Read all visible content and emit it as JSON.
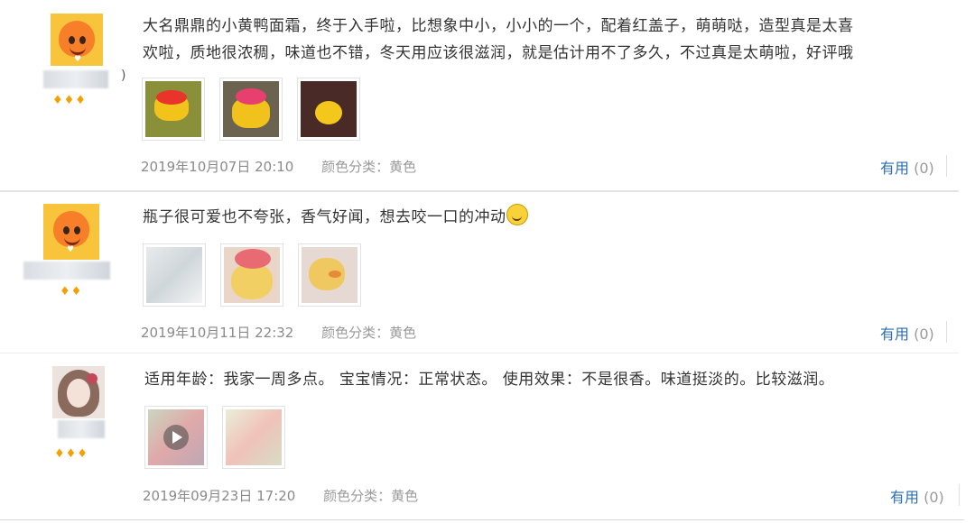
{
  "reviews": [
    {
      "text": "大名鼎鼎的小黄鸭面霜，终于入手啦，比想象中小，小小的一个，配着红盖子，萌萌哒，造型真是太喜欢啦，质地很浓稠，味道也不错，冬天用应该很滋润，就是估计用不了多久，不过真是太萌啦，好评哦",
      "text_line1": "大名鼎鼎的小黄鸭面霜，终于入手啦，比想象中小，小小的一个，配着红盖子，萌萌哒，造型真是太喜",
      "text_line2": "欢啦，质地很浓稠，味道也不错，冬天用应该很滋润，就是估计用不了多久，不过真是太萌啦，好评哦",
      "username_tail": ")",
      "level": "♦♦♦",
      "date": "2019年10月07日 20:10",
      "spec_label": "颜色分类：",
      "spec_value": "黄色",
      "useful_label": "有用",
      "useful_count": "(0)"
    },
    {
      "text": "瓶子很可爱也不夸张，香气好闻，想去咬一口的冲动",
      "level": "♦♦",
      "date": "2019年10月11日 22:32",
      "spec_label": "颜色分类：",
      "spec_value": "黄色",
      "useful_label": "有用",
      "useful_count": "(0)"
    },
    {
      "text": "适用年龄：我家一周多点。 宝宝情况：正常状态。 使用效果：不是很香。味道挺淡的。比较滋润。",
      "level": "♦♦♦",
      "date": "2019年09月23日 17:20",
      "spec_label": "颜色分类：",
      "spec_value": "黄色",
      "useful_label": "有用",
      "useful_count": "(0)"
    }
  ],
  "icons": {
    "avatar_duck": "duck-avatar-icon",
    "avatar_girl": "girl-avatar-icon",
    "emoji": "grin-emoji-icon",
    "level": "diamond-icon",
    "video": "play-icon"
  },
  "colors": {
    "link": "#2b6fb3",
    "level": "#f5a000",
    "meta": "#999999"
  }
}
